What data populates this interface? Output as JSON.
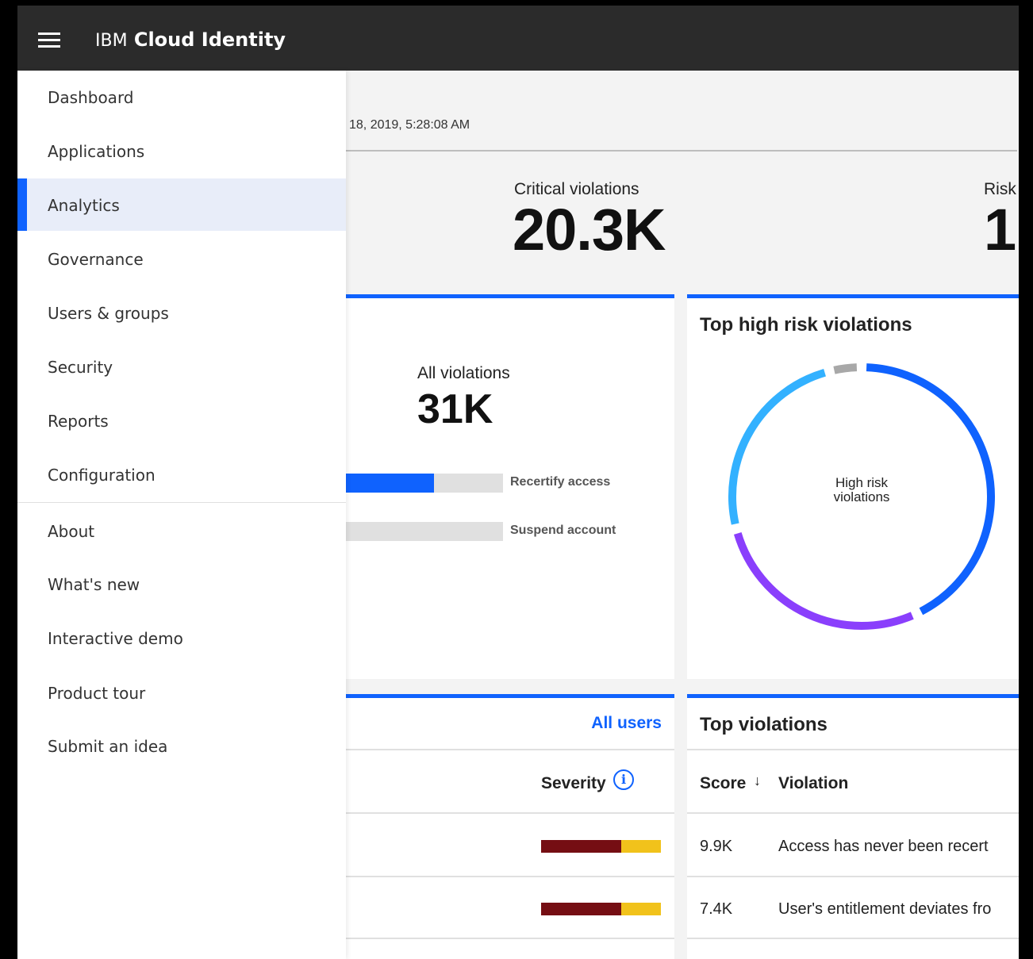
{
  "header": {
    "brand_prefix": "IBM",
    "brand_name": "Cloud Identity"
  },
  "page": {
    "timestamp": "18, 2019, 5:28:08 AM"
  },
  "kpis": [
    {
      "label": "Critical violations",
      "value": "20.3K"
    },
    {
      "label": "Risk",
      "value": "1"
    }
  ],
  "summary": {
    "label": "All violations",
    "value": "31K",
    "actions": [
      {
        "label": "Recertify access",
        "fraction": 0.56
      },
      {
        "label": "Suspend account",
        "fraction": 0.0
      }
    ]
  },
  "donut": {
    "title": "Top high risk violations",
    "center_label_1": "High risk",
    "center_label_2": "violations",
    "segments": [
      {
        "color": "#0f62fe",
        "value": 43
      },
      {
        "color": "#8a3ffc",
        "value": 28
      },
      {
        "color": "#33b1ff",
        "value": 25
      },
      {
        "color": "#a8a8a8",
        "value": 4
      }
    ]
  },
  "users_card": {
    "link": "All users",
    "severity_label": "Severity",
    "info_icon": "i",
    "rows": [
      {
        "high": 0.67,
        "medium": 0.33
      },
      {
        "high": 0.67,
        "medium": 0.33
      }
    ],
    "colors": {
      "high": "#750e13",
      "medium": "#f1c21b"
    }
  },
  "top_violations": {
    "title": "Top violations",
    "col_score": "Score",
    "sort_icon": "↓",
    "col_violation": "Violation",
    "rows": [
      {
        "score": "9.9K",
        "violation": "Access has never been recert"
      },
      {
        "score": "7.4K",
        "violation": "User's entitlement deviates fro"
      }
    ]
  },
  "sidebar": {
    "items": [
      {
        "label": "Dashboard"
      },
      {
        "label": "Applications"
      },
      {
        "label": "Analytics",
        "active": true
      },
      {
        "label": "Governance"
      },
      {
        "label": "Users & groups"
      },
      {
        "label": "Security"
      },
      {
        "label": "Reports"
      },
      {
        "label": "Configuration"
      }
    ],
    "secondary": [
      {
        "label": "About"
      },
      {
        "label": "What's new"
      },
      {
        "label": "Interactive demo"
      },
      {
        "label": "Product tour"
      },
      {
        "label": "Submit an idea"
      }
    ]
  }
}
